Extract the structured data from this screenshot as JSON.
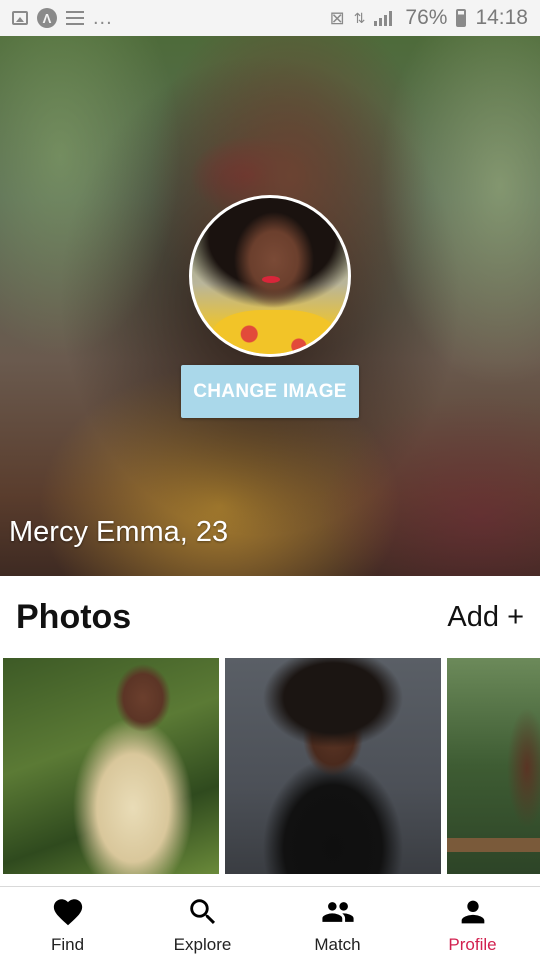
{
  "status_bar": {
    "notification_dots": "...",
    "battery_percent": "76%",
    "time": "14:18",
    "battery_level": 0.76
  },
  "profile": {
    "name_age": "Mercy Emma, 23",
    "change_image_label": "CHANGE IMAGE"
  },
  "photos": {
    "title": "Photos",
    "add_label": "Add +"
  },
  "nav": {
    "items": [
      {
        "label": "Find",
        "icon": "heart-icon"
      },
      {
        "label": "Explore",
        "icon": "search-icon"
      },
      {
        "label": "Match",
        "icon": "people-icon"
      },
      {
        "label": "Profile",
        "icon": "person-icon"
      }
    ],
    "active_index": 3,
    "active_color": "#d2214f"
  },
  "colors": {
    "change_button_bg": "#aad8ea",
    "status_bar_bg": "#f4f4f4"
  }
}
